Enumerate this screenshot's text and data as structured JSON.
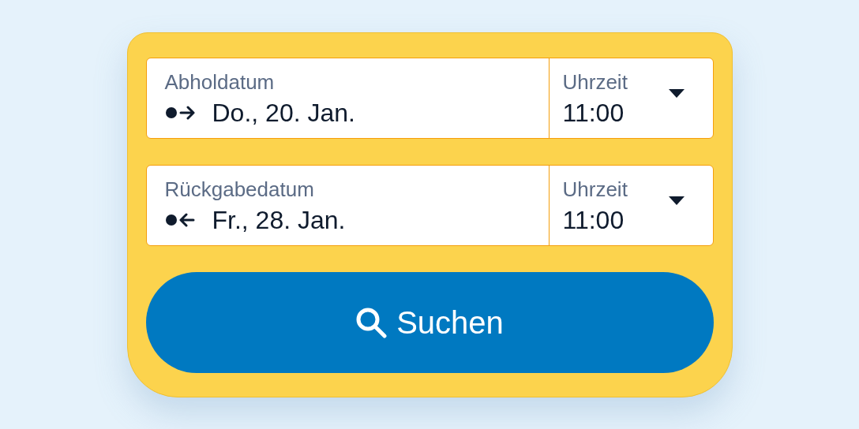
{
  "date_rows": [
    {
      "kind": "pickup",
      "date_label": "Abholdatum",
      "date_value": "Do., 20. Jan.",
      "time_label": "Uhrzeit",
      "time_value": "11:00"
    },
    {
      "kind": "return",
      "date_label": "Rückgabedatum",
      "date_value": "Fr., 28. Jan.",
      "time_label": "Uhrzeit",
      "time_value": "11:00"
    }
  ],
  "search_button": {
    "label": "Suchen"
  }
}
